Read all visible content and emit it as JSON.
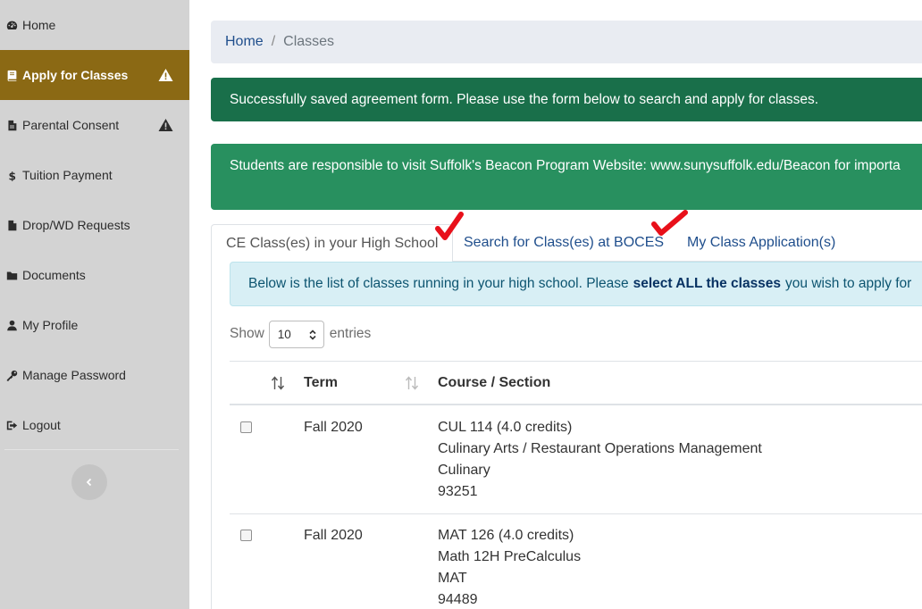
{
  "sidebar": {
    "items": [
      {
        "label": "Home",
        "icon": "dashboard-icon"
      },
      {
        "label": "Apply for Classes",
        "icon": "book-icon",
        "warning": true
      },
      {
        "label": "Parental Consent",
        "icon": "file-icon",
        "warning": true
      },
      {
        "label": "Tuition Payment",
        "icon": "dollar-icon"
      },
      {
        "label": "Drop/WD Requests",
        "icon": "file-icon"
      },
      {
        "label": "Documents",
        "icon": "folder-icon"
      },
      {
        "label": "My Profile",
        "icon": "user-icon"
      },
      {
        "label": "Manage Password",
        "icon": "key-icon"
      },
      {
        "label": "Logout",
        "icon": "sign-out-icon"
      }
    ],
    "active_color": "#8b6914"
  },
  "breadcrumb": {
    "home": "Home",
    "separator": "/",
    "current": "Classes"
  },
  "alerts": {
    "success": "Successfully saved agreement form. Please use the form below to search and apply for classes.",
    "info": "Students are responsible to visit Suffolk's Beacon Program Website: www.sunysuffolk.edu/Beacon for importa"
  },
  "tabs": [
    {
      "label": "CE Class(es) in your High School",
      "active": true
    },
    {
      "label": "Search for Class(es) at BOCES",
      "active": false
    },
    {
      "label": "My Class Application(s)",
      "active": false
    }
  ],
  "info_box": {
    "text_before": "Below is the list of classes running in your high school. Please ",
    "text_bold": "select ALL the classes",
    "text_after": " you wish to apply for"
  },
  "table_length": {
    "show": "Show",
    "value": "10",
    "entries": "entries"
  },
  "table": {
    "headers": {
      "term": "Term",
      "course": "Course / Section"
    },
    "rows": [
      {
        "term": "Fall 2020",
        "course": "CUL 114 (4.0 credits)",
        "title": "Culinary Arts / Restaurant Operations Management",
        "subject": "Culinary",
        "section": "93251"
      },
      {
        "term": "Fall 2020",
        "course": "MAT 126 (4.0 credits)",
        "title": "Math 12H PreCalculus",
        "subject": "MAT",
        "section": "94489"
      }
    ]
  }
}
